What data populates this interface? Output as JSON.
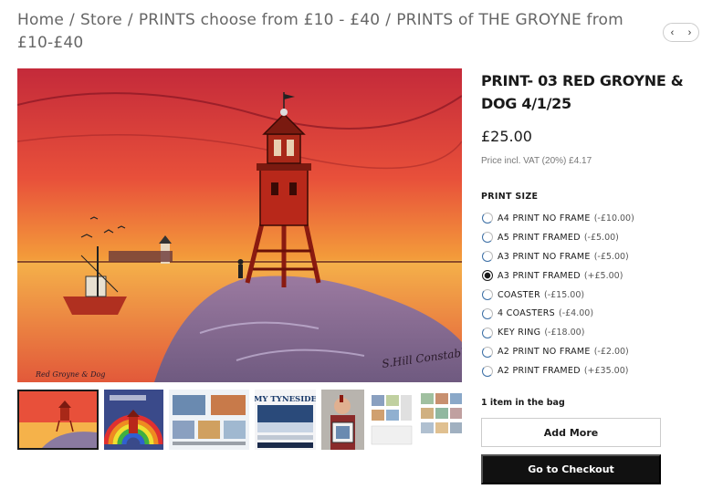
{
  "breadcrumb": {
    "items": [
      "Home",
      "Store",
      "PRINTS choose from £10 - £40",
      "PRINTS of THE GROYNE from £10-£40"
    ],
    "separator": "/"
  },
  "pager": {
    "prev_icon": "chevron-left-icon",
    "next_icon": "chevron-right-icon",
    "prev": "‹",
    "next": "›"
  },
  "product": {
    "title": "PRINT- 03 RED GROYNE & DOG 4/1/25",
    "price": "£25.00",
    "vat": "Price incl. VAT (20%) £4.17"
  },
  "options": {
    "label": "PRINT SIZE",
    "items": [
      {
        "name": "A4 PRINT NO FRAME",
        "mod": "(-£10.00)",
        "checked": false
      },
      {
        "name": "A5 PRINT FRAMED",
        "mod": "(-£5.00)",
        "checked": false
      },
      {
        "name": "A3 PRINT NO FRAME",
        "mod": "(-£5.00)",
        "checked": false
      },
      {
        "name": "A3 PRINT FRAMED",
        "mod": "(+£5.00)",
        "checked": true
      },
      {
        "name": "COASTER",
        "mod": "(-£15.00)",
        "checked": false
      },
      {
        "name": "4 COASTERS",
        "mod": "(-£4.00)",
        "checked": false
      },
      {
        "name": "KEY RING",
        "mod": "(-£18.00)",
        "checked": false
      },
      {
        "name": "A2 PRINT NO FRAME",
        "mod": "(-£2.00)",
        "checked": false
      },
      {
        "name": "A2 PRINT FRAMED",
        "mod": "(+£35.00)",
        "checked": false
      }
    ]
  },
  "bag": {
    "status": "1 item in the bag"
  },
  "buttons": {
    "add_more": "Add More",
    "checkout": "Go to Checkout"
  },
  "thumbnails": [
    {
      "name": "red-groyne-thumb"
    },
    {
      "name": "rainbow-groyne-thumb"
    },
    {
      "name": "prints-collection-thumb"
    },
    {
      "name": "my-tyneside-thumb",
      "text": "MY TYNESIDE"
    },
    {
      "name": "person-holding-print-thumb"
    },
    {
      "name": "print-sheet-thumb"
    },
    {
      "name": "print-sheet-2-thumb"
    }
  ],
  "colors": {
    "accent": "#1a1a1a",
    "checkout_bg": "#111111",
    "radio_accent": "#3a6ea5"
  }
}
